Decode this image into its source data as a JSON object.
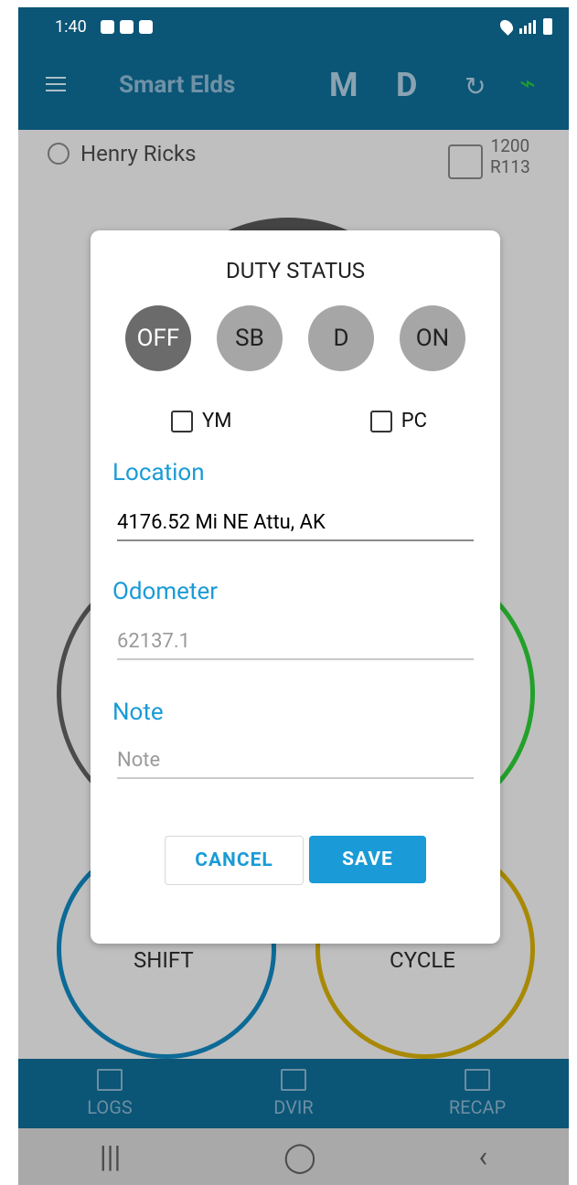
{
  "status_bar": {
    "time": "1:40"
  },
  "app_bar": {
    "title": "Smart Elds",
    "mode_m": "M",
    "mode_d": "D"
  },
  "driver": {
    "name": "Henry Ricks",
    "unit_number": "1200",
    "trailer": "R113"
  },
  "gauges": {
    "shift_label": "SHIFT",
    "cycle_label": "CYCLE"
  },
  "dialog": {
    "title": "DUTY STATUS",
    "statuses": [
      "OFF",
      "SB",
      "D",
      "ON"
    ],
    "selected": "OFF",
    "checkboxes": {
      "ym_label": "YM",
      "pc_label": "PC",
      "ym_checked": false,
      "pc_checked": false
    },
    "location": {
      "label": "Location",
      "value": "4176.52 Mi NE Attu, AK"
    },
    "odometer": {
      "label": "Odometer",
      "value": "62137.1"
    },
    "note": {
      "label": "Note",
      "placeholder": "Note",
      "value": ""
    },
    "buttons": {
      "cancel": "CANCEL",
      "save": "SAVE"
    }
  },
  "bottom_nav": [
    "LOGS",
    "DVIR",
    "RECAP"
  ],
  "colors": {
    "primary": "#0B5576",
    "accent": "#1A9BD7",
    "status_active": "#6B6B6B",
    "status_inactive": "#A6A6A6"
  }
}
